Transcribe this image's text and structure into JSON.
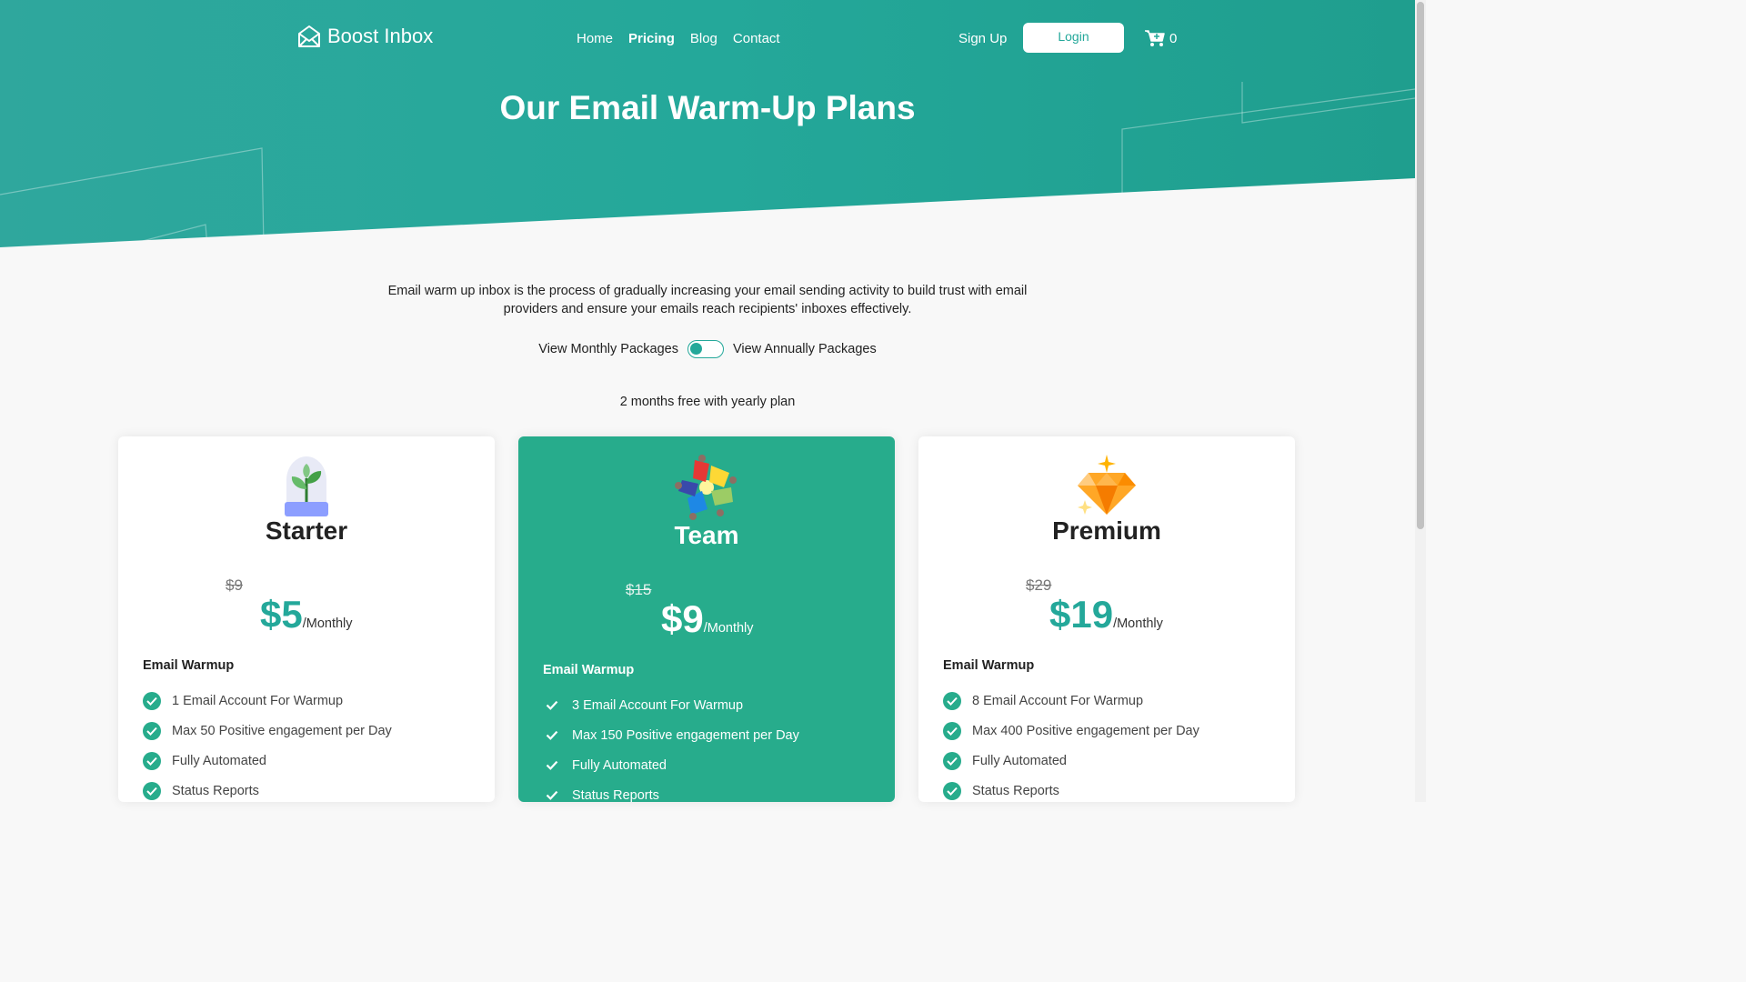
{
  "nav": {
    "brand": "Boost Inbox",
    "links": [
      {
        "label": "Home",
        "active": false
      },
      {
        "label": "Pricing",
        "active": true
      },
      {
        "label": "Blog",
        "active": false
      },
      {
        "label": "Contact",
        "active": false
      }
    ],
    "signup_label": "Sign Up",
    "login_label": "Login",
    "cart_count": "0"
  },
  "hero": {
    "title": "Our Email Warm-Up Plans"
  },
  "intro": {
    "description": "Email warm up inbox is the process of gradually increasing your email sending activity to build trust with email providers and ensure your emails reach recipients' inboxes effectively.",
    "toggle_monthly": "View Monthly Packages",
    "toggle_annual": "View Annually Packages",
    "free_note": "2 months free with yearly plan"
  },
  "plans": [
    {
      "name": "Starter",
      "old_price": "$9",
      "price": "$5",
      "period": "/Monthly",
      "features_heading": "Email Warmup",
      "features": [
        "1 Email Account For Warmup",
        "Max 50 Positive engagement per Day",
        "Fully Automated",
        "Status Reports"
      ]
    },
    {
      "name": "Team",
      "old_price": "$15",
      "price": "$9",
      "period": "/Monthly",
      "features_heading": "Email Warmup",
      "features": [
        "3 Email Account For Warmup",
        "Max 150 Positive engagement per Day",
        "Fully Automated",
        "Status Reports"
      ]
    },
    {
      "name": "Premium",
      "old_price": "$29",
      "price": "$19",
      "period": "/Monthly",
      "features_heading": "Email Warmup",
      "features": [
        "8 Email Account For Warmup",
        "Max 400 Positive engagement per Day",
        "Fully Automated",
        "Status Reports"
      ]
    }
  ],
  "colors": {
    "accent": "#24a89a",
    "featured_card": "#27ac8c"
  }
}
